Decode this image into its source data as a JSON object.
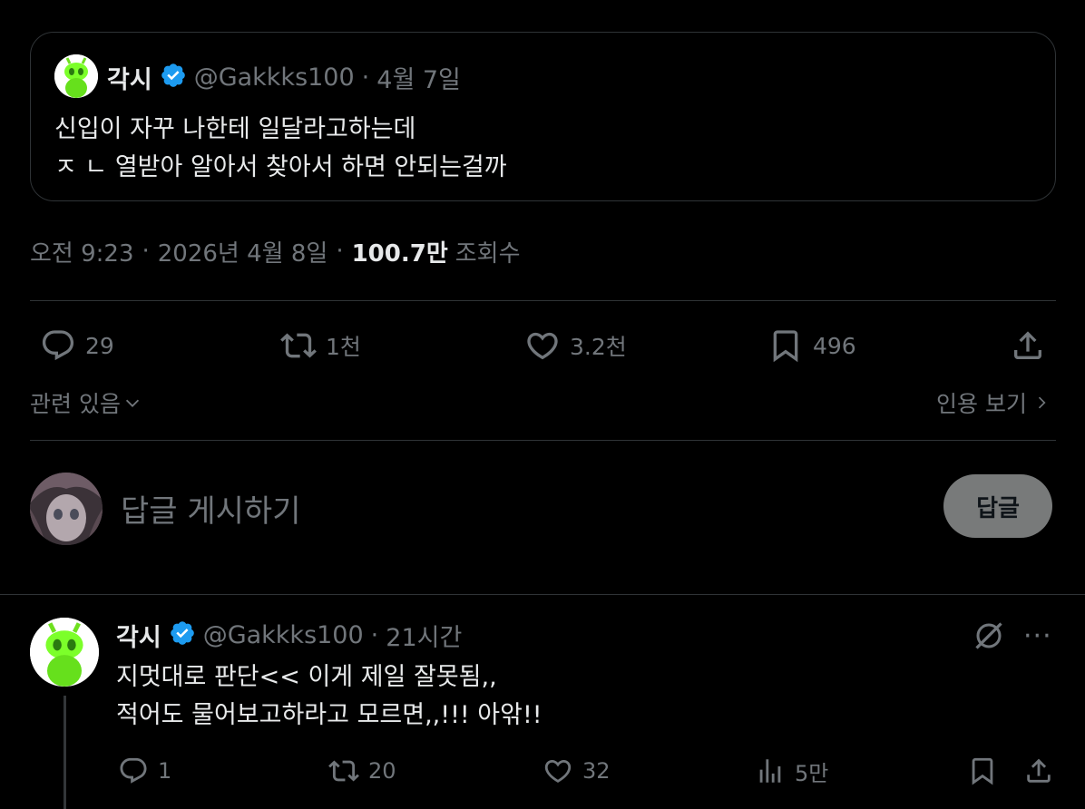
{
  "quote": {
    "name": "각시",
    "handle": "@Gakkks100",
    "separator": "·",
    "date": "4월 7일",
    "lines": [
      "신입이 자꾸 나한테 일달라고하는데",
      "ㅈ ㄴ 열받아 알아서 찾아서 하면 안되는걸까"
    ]
  },
  "meta": {
    "time": "오전 9:23",
    "date": "2026년 4월 8일",
    "views": "100.7만",
    "views_label": "조회수",
    "separator": "·"
  },
  "actions": {
    "replies": "29",
    "reposts": "1천",
    "likes": "3.2천",
    "bookmarks": "496"
  },
  "links": {
    "related": "관련 있음",
    "quotes": "인용 보기"
  },
  "composer": {
    "placeholder": "답글 게시하기",
    "button": "답글"
  },
  "reply": {
    "name": "각시",
    "handle": "@Gakkks100",
    "separator": "·",
    "time": "21시간",
    "lines": [
      "지멋대로 판단<< 이게 제일 잘못됨,,",
      "적어도 물어보고하라고 모르면,,!!! 아앆!!"
    ],
    "more": "···",
    "actions": {
      "replies": "1",
      "reposts": "20",
      "likes": "32",
      "views": "5만"
    }
  },
  "colors": {
    "background": "#000000",
    "text": "#e7e9ea",
    "muted": "#71767b",
    "border": "#2f3336",
    "verified": "#1d9bf0",
    "alien": "#7cff2a"
  },
  "icons": [
    "reply-icon",
    "repost-icon",
    "like-icon",
    "bookmark-icon",
    "share-icon",
    "views-icon",
    "verified-badge-icon",
    "grok-icon",
    "more-icon",
    "chevron-down-icon",
    "chevron-right-icon"
  ]
}
